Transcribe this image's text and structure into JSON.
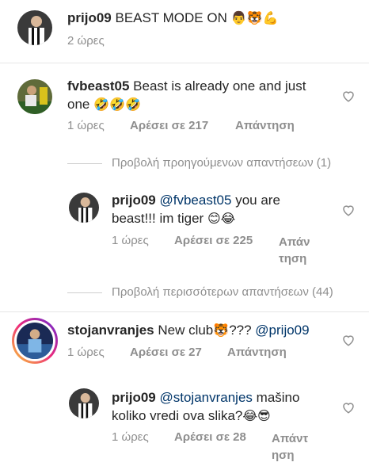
{
  "caption": {
    "username": "prijo09",
    "text": "BEAST MODE ON",
    "emoji": "👨🐯💪",
    "time": "2 ώρες"
  },
  "comments": [
    {
      "username": "fvbeast05",
      "text_line1": "Beast is already one and just",
      "text_line2": "one",
      "emoji": "🤣🤣🤣",
      "time": "1 ώρες",
      "likes": "Αρέσει σε 217",
      "reply": "Απάντηση"
    },
    {
      "username": "prijo09",
      "mention": "@fvbeast05",
      "text_line1": "you are",
      "text_line2": "beast!!! im tiger",
      "emoji": "😊😂",
      "time": "1 ώρες",
      "likes": "Αρέσει σε 225",
      "reply_line1": "Απάν",
      "reply_line2": "τηση"
    },
    {
      "username": "stojanvranjes",
      "text": "New club",
      "emoji": "🐯",
      "text_after": "???",
      "mention": "@prijo09",
      "time": "1 ώρες",
      "likes": "Αρέσει σε 27",
      "reply": "Απάντηση"
    },
    {
      "username": "prijo09",
      "mention": "@stojanvranjes",
      "text_line1": "mašino",
      "text_line2": "koliko vredi ova slika?",
      "emoji": "😂😎",
      "time": "1 ώρες",
      "likes": "Αρέσει σε 28",
      "reply_line1": "Απάντ",
      "reply_line2": "ηση"
    }
  ],
  "threads": {
    "previous": "Προβολή προηγούμενων απαντήσεων (1)",
    "more": "Προβολή περισσότερων απαντήσεων (44)"
  },
  "colors": {
    "text": "#262626",
    "muted": "#8e8e8e",
    "mention": "#003569",
    "story_ring": "#d6249f"
  }
}
